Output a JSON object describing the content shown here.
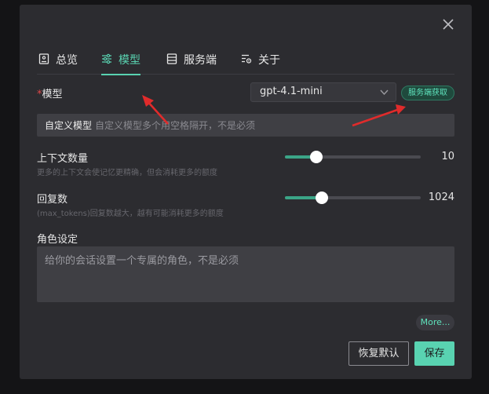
{
  "tabs": [
    {
      "label": "总览",
      "icon": "document-icon"
    },
    {
      "label": "模型",
      "icon": "sliders-icon",
      "active": true
    },
    {
      "label": "服务端",
      "icon": "server-icon"
    },
    {
      "label": "关于",
      "icon": "settings-list-icon"
    }
  ],
  "model": {
    "required_mark": "*",
    "label": "模型",
    "selected": "gpt-4.1-mini",
    "fetch_button": "服务端获取"
  },
  "custom_model": {
    "label": "自定义模型",
    "placeholder": "自定义模型多个用空格隔开，不是必须"
  },
  "context": {
    "label": "上下文数量",
    "hint": "更多的上下文会使记忆更精确，但会消耗更多的额度",
    "value": "10",
    "fraction": 0.23
  },
  "max_tokens": {
    "label": "回复数",
    "hint": "(max_tokens)回复数越大，越有可能消耗更多的额度",
    "value": "1024",
    "fraction": 0.27
  },
  "role": {
    "label": "角色设定",
    "placeholder": "给你的会话设置一个专属的角色，不是必须"
  },
  "more_button": "More...",
  "reset_button": "恢复默认",
  "save_button": "保存",
  "colors": {
    "accent": "#59d3b1",
    "dialog_bg": "#2c2c30",
    "annotation_arrow": "#e02b2b"
  }
}
